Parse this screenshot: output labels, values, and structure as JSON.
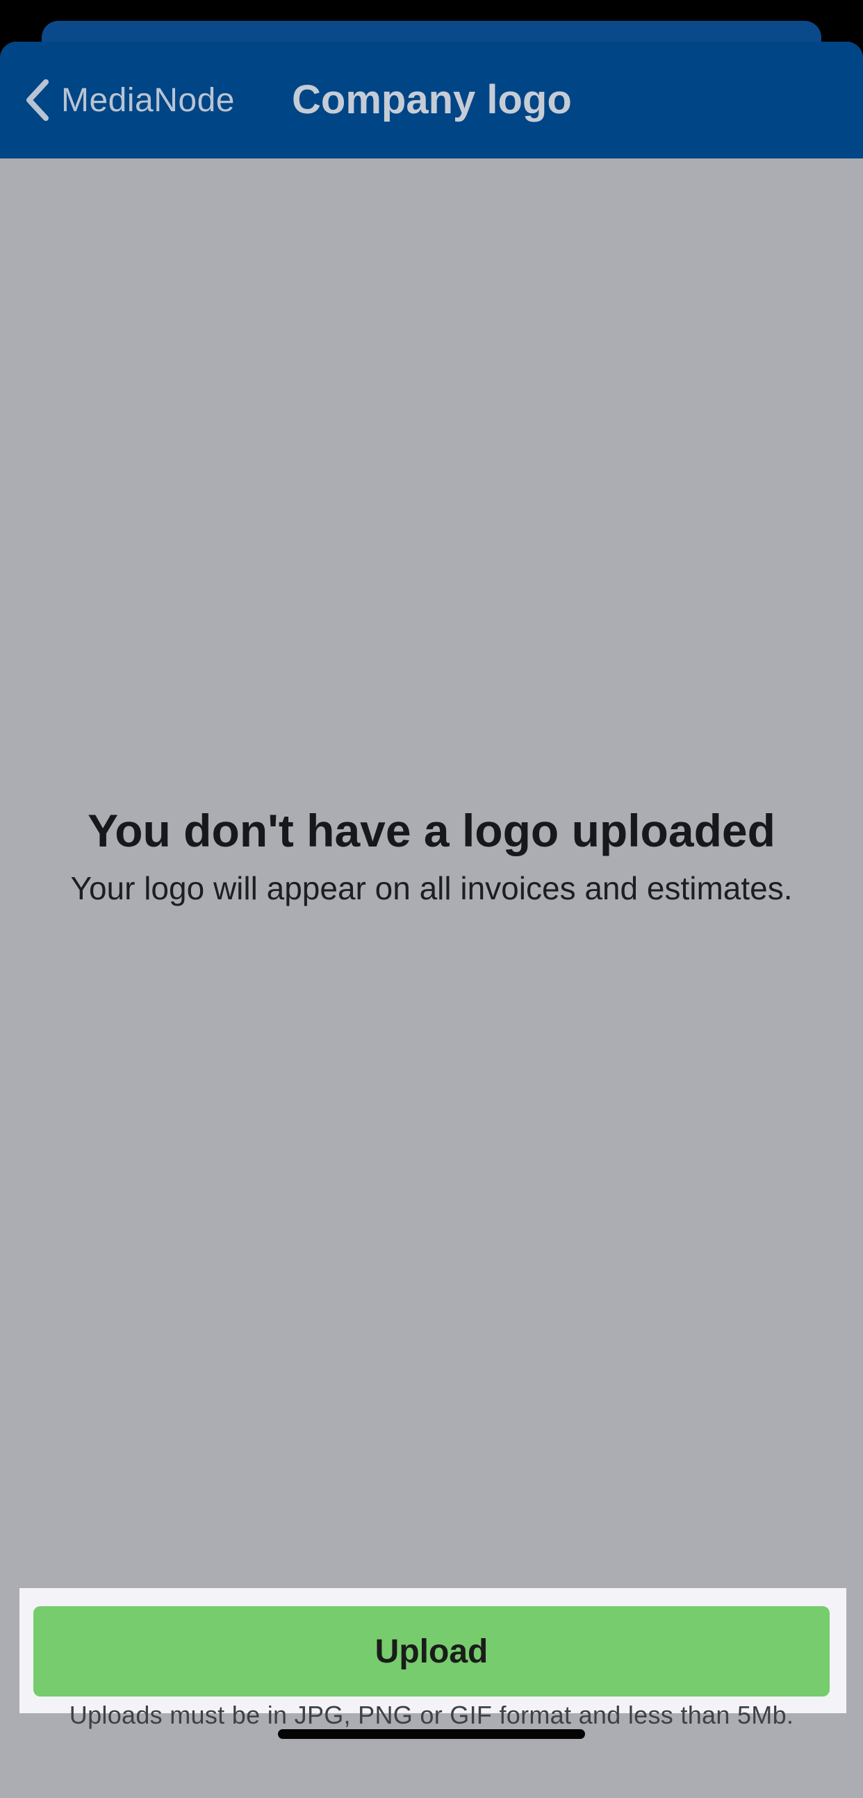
{
  "navbar": {
    "back_label": "MediaNode",
    "title": "Company logo"
  },
  "empty_state": {
    "title": "You don't have a logo uploaded",
    "subtitle": "Your logo will appear on all invoices and estimates."
  },
  "upload": {
    "button_label": "Upload",
    "note": "Uploads must be in JPG, PNG or GIF format and less than 5Mb."
  },
  "colors": {
    "navbar_background": "#004586",
    "content_background": "#acadb2",
    "upload_button": "#77cc6d",
    "upload_panel": "#f4f4f8"
  },
  "icons": {
    "back": "chevron-left-icon"
  }
}
